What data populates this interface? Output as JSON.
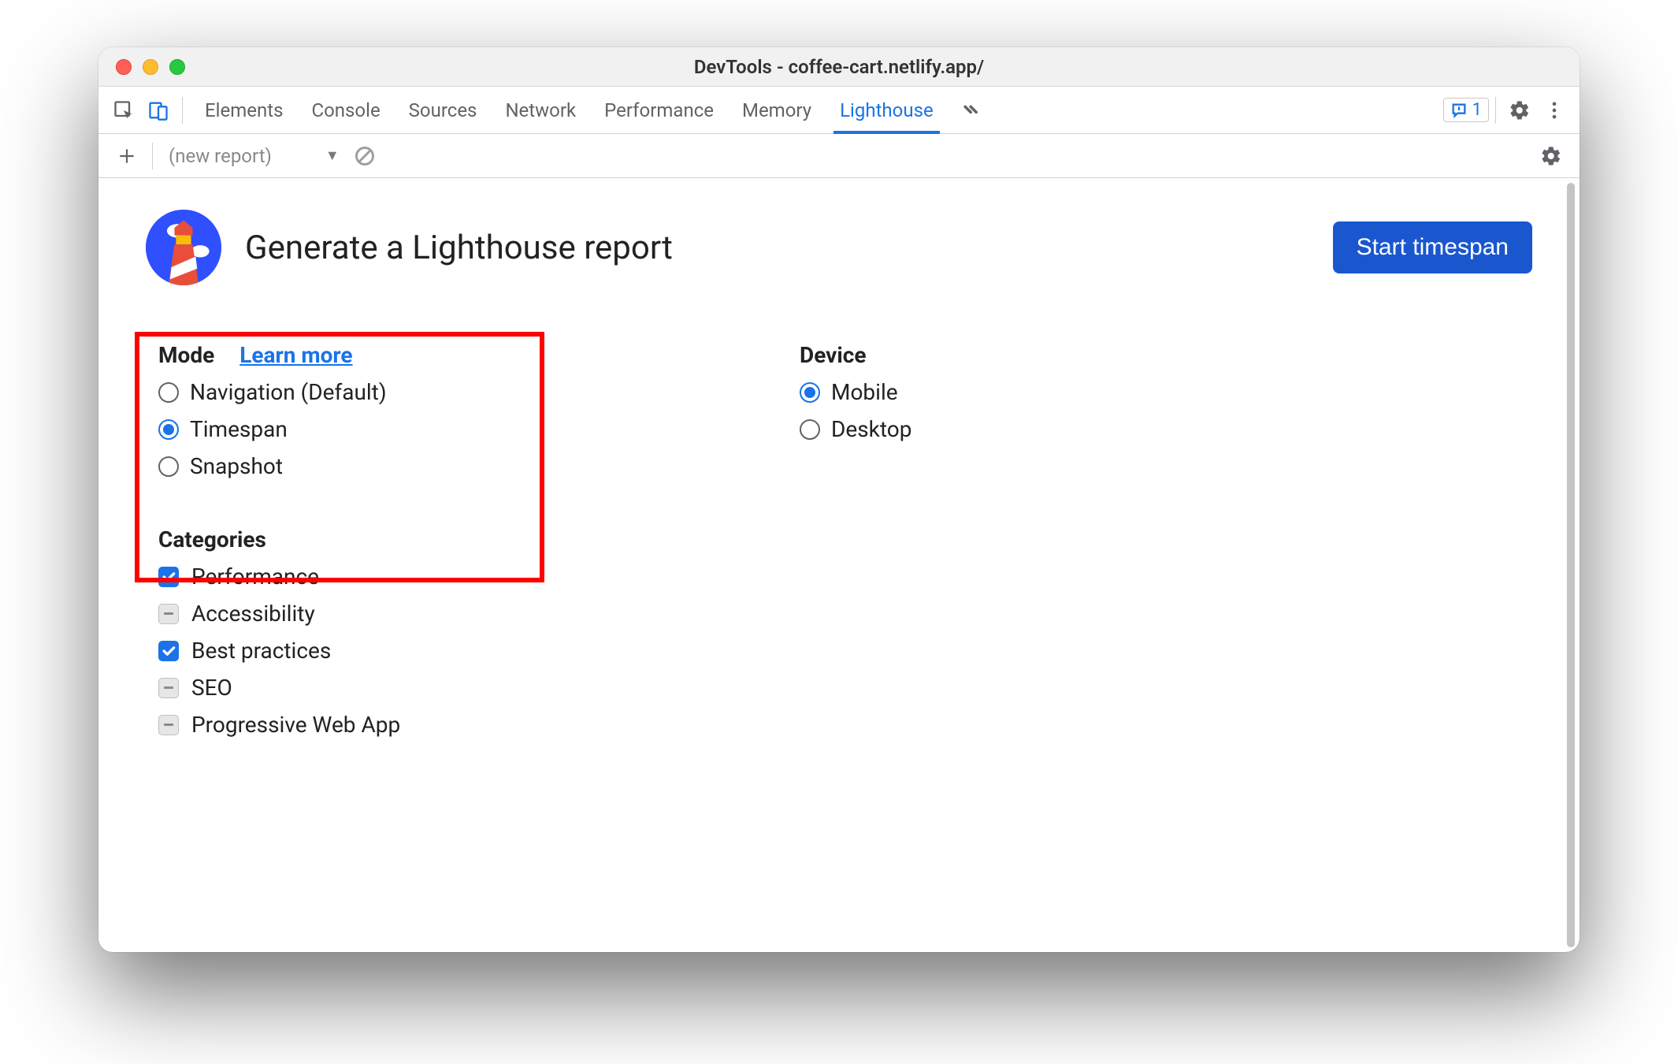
{
  "titlebar": {
    "title": "DevTools - coffee-cart.netlify.app/"
  },
  "tabs": {
    "items": [
      {
        "label": "Elements"
      },
      {
        "label": "Console"
      },
      {
        "label": "Sources"
      },
      {
        "label": "Network"
      },
      {
        "label": "Performance"
      },
      {
        "label": "Memory"
      },
      {
        "label": "Lighthouse"
      }
    ],
    "active_index": 6,
    "issues_count": "1"
  },
  "lh_toolbar": {
    "dropdown_label": "(new report)"
  },
  "header": {
    "page_title": "Generate a Lighthouse report",
    "start_button": "Start timespan"
  },
  "mode": {
    "title": "Mode",
    "learn_more": "Learn more",
    "options": [
      {
        "label": "Navigation (Default)",
        "selected": false
      },
      {
        "label": "Timespan",
        "selected": true
      },
      {
        "label": "Snapshot",
        "selected": false
      }
    ]
  },
  "device": {
    "title": "Device",
    "options": [
      {
        "label": "Mobile",
        "selected": true
      },
      {
        "label": "Desktop",
        "selected": false
      }
    ]
  },
  "categories": {
    "title": "Categories",
    "items": [
      {
        "label": "Performance",
        "state": "checked"
      },
      {
        "label": "Accessibility",
        "state": "indeterminate"
      },
      {
        "label": "Best practices",
        "state": "checked"
      },
      {
        "label": "SEO",
        "state": "indeterminate"
      },
      {
        "label": "Progressive Web App",
        "state": "indeterminate"
      }
    ]
  },
  "colors": {
    "accent": "#1a73e8",
    "button": "#1a57cf",
    "highlight": "#ff0000"
  }
}
